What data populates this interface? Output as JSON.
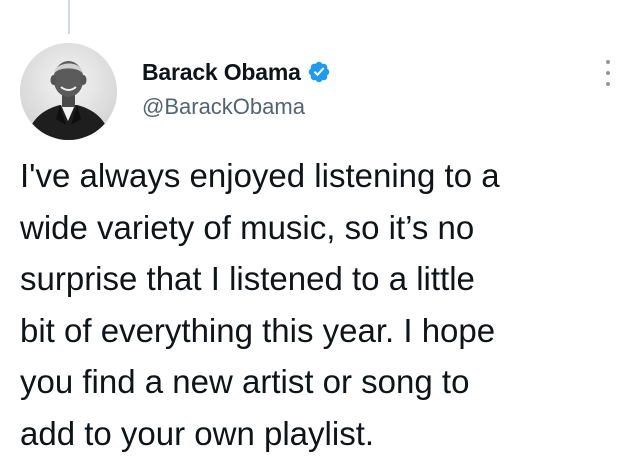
{
  "author": {
    "display_name": "Barack Obama",
    "handle": "@BarackObama",
    "verified": true,
    "avatar_icon": "profile-photo"
  },
  "tweet": {
    "lines": [
      "I've always enjoyed listening to a",
      "wide variety of music, so it’s no",
      "surprise that I listened to a little",
      "bit of everything this year. I hope",
      "you find a new artist or song to",
      "add to your own playlist."
    ]
  },
  "icons": {
    "verified": "verified-badge-icon",
    "more": "more-options-icon"
  },
  "colors": {
    "verified_blue": "#1d9bf0",
    "text_primary": "#0f1419",
    "text_secondary": "#536471",
    "thread_line": "#cfd9de"
  }
}
